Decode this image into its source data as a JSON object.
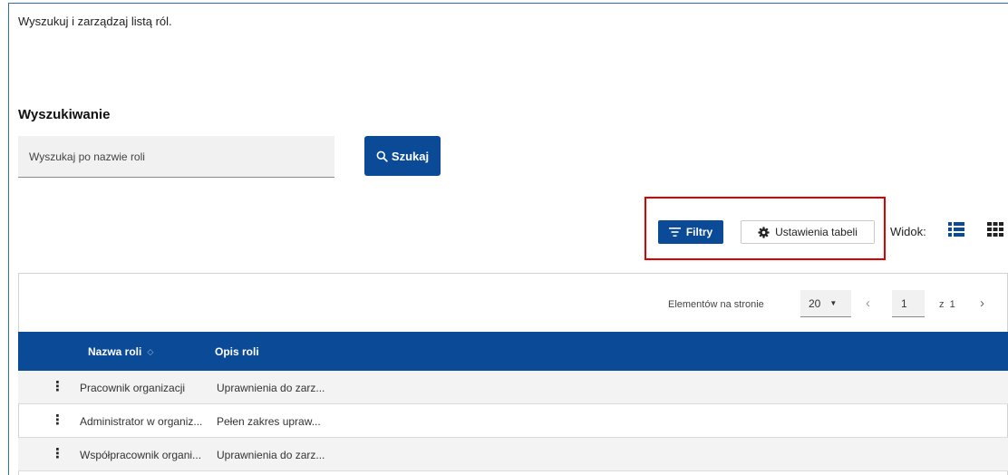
{
  "page": {
    "description": "Wyszukuj i zarządzaj listą ról.",
    "search_section_title": "Wyszukiwanie"
  },
  "search": {
    "placeholder": "Wyszukaj po nazwie roli",
    "value": "",
    "button_label": "Szukaj",
    "button_icon": "search-icon"
  },
  "toolbar": {
    "filters_label": "Filtry",
    "filters_icon": "filter-icon",
    "settings_label": "Ustawienia tabeli",
    "settings_icon": "gear-icon",
    "view_label": "Widok:",
    "view_icons": [
      "list-view-icon",
      "grid-view-icon"
    ],
    "highlight_color": "#e00000"
  },
  "pagination": {
    "per_page_label": "Elementów na stronie",
    "per_page_value": "20",
    "current_page": "1",
    "of_label": "z",
    "total_pages": "1"
  },
  "table": {
    "columns": [
      {
        "label": "Nazwa roli",
        "sortable": true
      },
      {
        "label": "Opis roli"
      }
    ],
    "rows": [
      {
        "name": "Pracownik organizacji",
        "description": "Uprawnienia do zarz..."
      },
      {
        "name": "Administrator w organiz...",
        "description": "Pełen zakres upraw..."
      },
      {
        "name": "Współpracownik organi...",
        "description": "Uprawnienia do zarz..."
      }
    ]
  },
  "colors": {
    "primary": "#0b4a96",
    "border": "#2f6fad",
    "row_alt": "#f3f3f3"
  }
}
